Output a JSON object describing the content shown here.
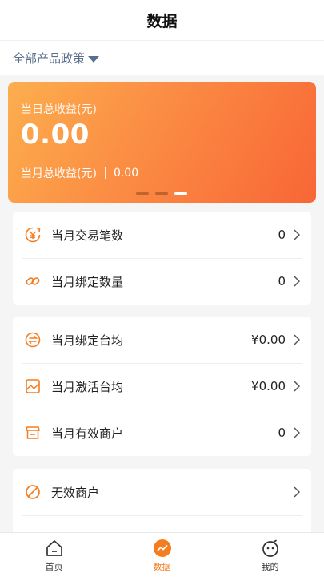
{
  "header": {
    "title": "数据"
  },
  "filter": {
    "label": "全部产品政策"
  },
  "hero": {
    "today_label": "当日总收益(元)",
    "today_value": "0.00",
    "month_label": "当月总收益(元)",
    "month_value": "0.00"
  },
  "group1": [
    {
      "icon": "yuan-circle-icon",
      "label": "当月交易笔数",
      "value": "0"
    },
    {
      "icon": "link-icon",
      "label": "当月绑定数量",
      "value": "0"
    }
  ],
  "group2": [
    {
      "icon": "exchange-circle-icon",
      "label": "当月绑定台均",
      "value": "¥0.00"
    },
    {
      "icon": "trend-chart-icon",
      "label": "当月激活台均",
      "value": "¥0.00"
    },
    {
      "icon": "shop-icon",
      "label": "当月有效商户",
      "value": "0"
    }
  ],
  "group3": [
    {
      "icon": "ban-icon",
      "label": "无效商户",
      "value": ""
    }
  ],
  "tabbar": {
    "home": "首页",
    "data": "数据",
    "mine": "我的"
  },
  "colors": {
    "accent": "#f57d1f",
    "filter_text": "#5a6f8d"
  }
}
